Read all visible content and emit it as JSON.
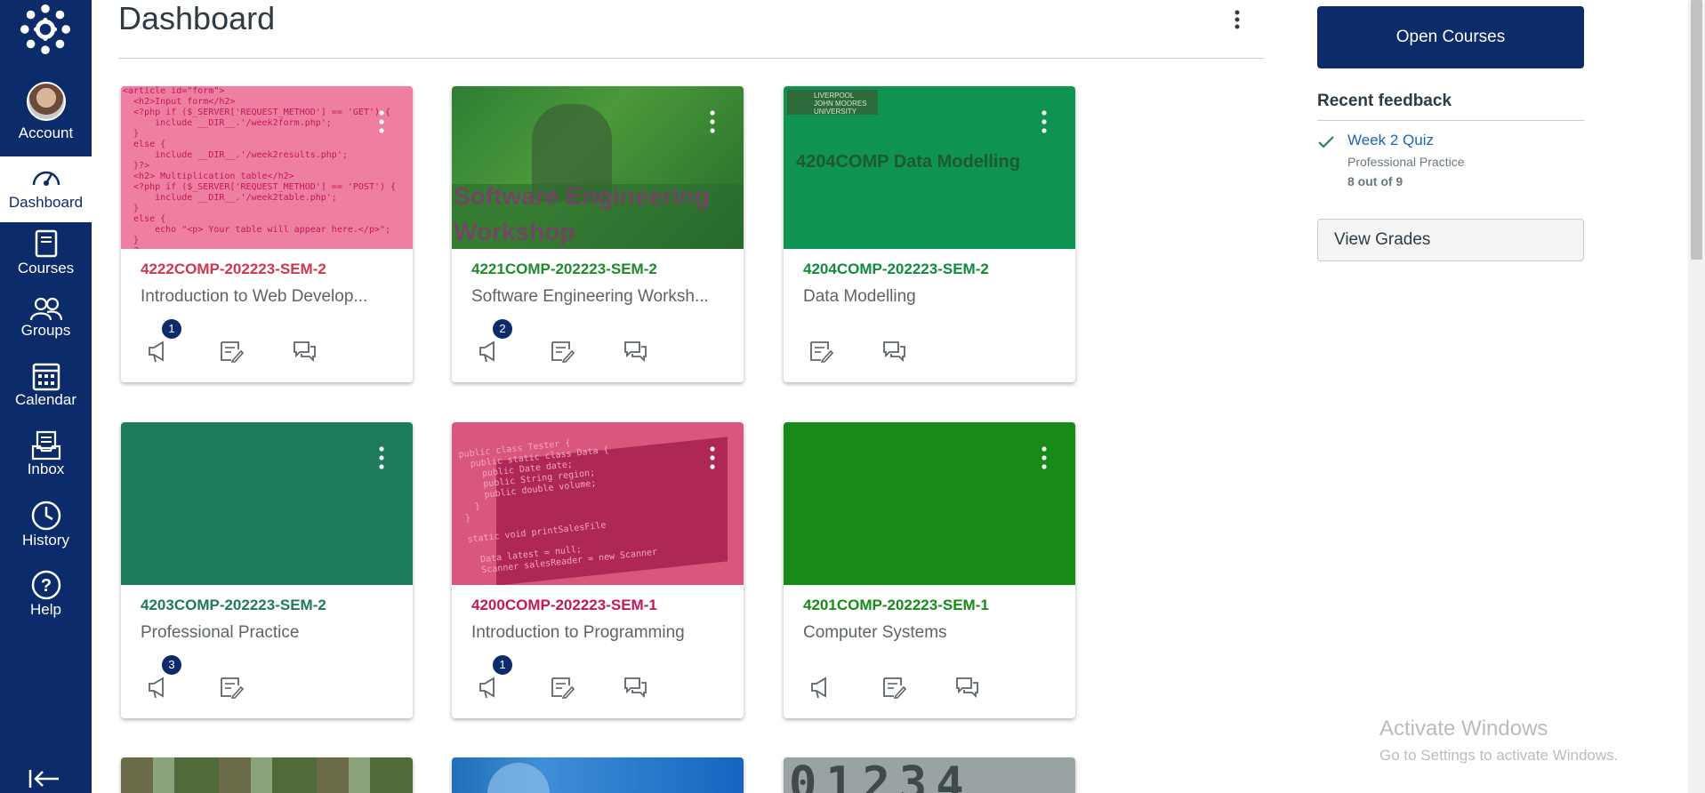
{
  "nav": {
    "account": "Account",
    "dashboard": "Dashboard",
    "courses": "Courses",
    "groups": "Groups",
    "calendar": "Calendar",
    "inbox": "Inbox",
    "history": "History",
    "help": "Help"
  },
  "page": {
    "title": "Dashboard"
  },
  "cards": [
    {
      "code": "4222COMP-202223-SEM-2",
      "name": "Introduction to Web Develop...",
      "color": "#d0374e",
      "badge": "1",
      "hero_code": "<article id=\"form\">\n  <h2>Input form</h2>\n  <?php if ($_SERVER['REQUEST_METHOD'] == 'GET') {\n      include __DIR__.'/week2form.php';\n  }\n  else {\n      include __DIR__.'/week2results.php';\n  }?>\n  <h2> Multiplication table</h2>\n  <?php if ($_SERVER['REQUEST_METHOD'] == 'POST') {\n      include __DIR__.'/week2table.php';\n  }\n  else {\n      echo \"<p> Your table will appear here.</p>\";\n  }\n  ?>"
    },
    {
      "code": "4221COMP-202223-SEM-2",
      "name": "Software Engineering Worksh...",
      "color": "#1f8a2c",
      "badge": "2",
      "hero_title": "Software Engineering Workshop"
    },
    {
      "code": "4204COMP-202223-SEM-2",
      "name": "Data Modelling",
      "color": "#0f8a3e",
      "hero_title": "4204COMP Data Modelling",
      "logo_text": "LIVERPOOL JOHN MOORES UNIVERSITY"
    },
    {
      "code": "4203COMP-202223-SEM-2",
      "name": "Professional Practice",
      "color": "#1d7a5c",
      "badge": "3"
    },
    {
      "code": "4200COMP-202223-SEM-1",
      "name": "Introduction to Programming",
      "color": "#c2185b",
      "badge": "1",
      "hero_code": "public class Tester {\n  public static class Data {\n    public Date date;\n    public String region;\n    public double volume;\n  }\n}\n\nstatic void printSalesFile\n\n  Data latest = null;\n  Scanner salesReader = new Scanner"
    },
    {
      "code": "4201COMP-202223-SEM-1",
      "name": "Computer Systems",
      "color": "#178a17"
    }
  ],
  "right": {
    "open_courses": "Open Courses",
    "recent_feedback": "Recent feedback",
    "feedback": {
      "title": "Week 2 Quiz",
      "course": "Professional Practice",
      "score": "8 out of 9"
    },
    "view_grades": "View Grades"
  },
  "watermark": {
    "line1": "Activate Windows",
    "line2": "Go to Settings to activate Windows."
  }
}
